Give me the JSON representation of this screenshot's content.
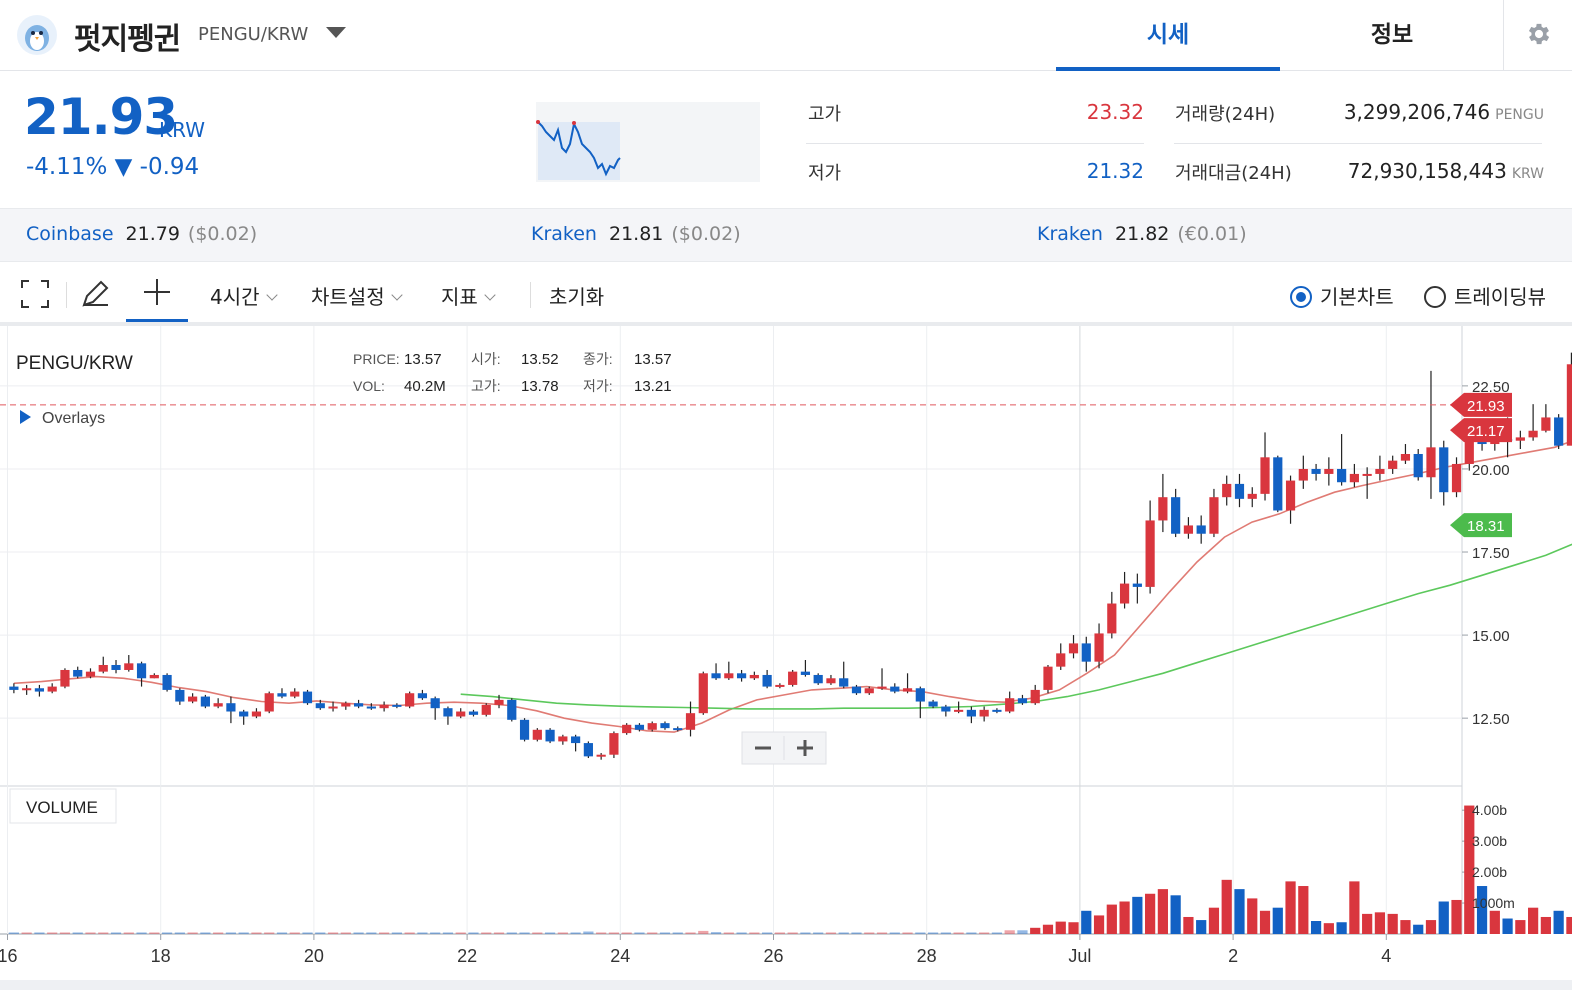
{
  "header": {
    "coin_name": "펏지펭귄",
    "pair": "PENGU/KRW",
    "tabs": [
      {
        "label": "시세",
        "active": true
      },
      {
        "label": "정보",
        "active": false
      }
    ]
  },
  "price": {
    "current": "21.93",
    "unit": "KRW",
    "change": "-4.11% ▼ -0.94",
    "color": "#1261c4"
  },
  "stats": {
    "high_label": "고가",
    "high": "23.32",
    "high_color": "#d9363e",
    "low_label": "저가",
    "low": "21.32",
    "low_color": "#1261c4",
    "volume_label": "거래량(24H)",
    "volume": "3,299,206,746",
    "volume_unit": "PENGU",
    "amount_label": "거래대금(24H)",
    "amount": "72,930,158,443",
    "amount_unit": "KRW"
  },
  "exchanges": [
    {
      "name": "Coinbase",
      "price": "21.79",
      "usd": "($0.02)"
    },
    {
      "name": "Kraken",
      "price": "21.81",
      "usd": "($0.02)"
    },
    {
      "name": "Kraken",
      "price": "21.82",
      "usd": "(€0.01)"
    }
  ],
  "toolbar": {
    "interval": "4시간",
    "chart_settings": "차트설정",
    "indicators": "지표",
    "reset": "초기화",
    "radio_basic": "기본차트",
    "radio_trading": "트레이딩뷰"
  },
  "chart_data": {
    "type": "candlestick",
    "symbol": "PENGU/KRW",
    "legend": {
      "price_label": "PRICE:",
      "price": "13.57",
      "open_label": "시가:",
      "open": "13.52",
      "close_label": "종가:",
      "close": "13.57",
      "vol_label": "VOL:",
      "vol": "40.2M",
      "high_label": "고가:",
      "high": "13.78",
      "low_label": "저가:",
      "low": "13.21"
    },
    "overlays_label": "Overlays",
    "volume_label": "VOLUME",
    "x_ticks": [
      "16",
      "18",
      "20",
      "22",
      "24",
      "26",
      "28",
      "Jul",
      "2",
      "4"
    ],
    "y_ticks": [
      "22.50",
      "20.00",
      "17.50",
      "15.00",
      "12.50"
    ],
    "volume_ticks": [
      "4.00b",
      "3.00b",
      "2.00b",
      "1000m"
    ],
    "ylim": [
      11.0,
      23.7
    ],
    "volume_lim": [
      0,
      4.2
    ],
    "current_price": "21.93",
    "ma_short_value": "21.17",
    "ma_long_value": "18.31",
    "colors": {
      "up": "#d9363e",
      "down": "#1261c4",
      "ma_short": "#e07b74",
      "ma_long": "#5cc85c",
      "ma_long_tag": "#4cbb4c"
    },
    "candles_per_day": 6,
    "first_candle_day": 16,
    "candles": [
      [
        13.45,
        13.35,
        13.55,
        13.25
      ],
      [
        13.35,
        13.4,
        13.5,
        13.2
      ],
      [
        13.4,
        13.3,
        13.5,
        13.15
      ],
      [
        13.3,
        13.45,
        13.55,
        13.25
      ],
      [
        13.45,
        13.95,
        14.0,
        13.4
      ],
      [
        13.95,
        13.75,
        14.05,
        13.7
      ],
      [
        13.75,
        13.9,
        14.0,
        13.7
      ],
      [
        13.9,
        14.1,
        14.35,
        13.85
      ],
      [
        14.1,
        13.95,
        14.25,
        13.85
      ],
      [
        13.95,
        14.15,
        14.4,
        13.9
      ],
      [
        14.15,
        13.7,
        14.2,
        13.45
      ],
      [
        13.7,
        13.8,
        13.85,
        13.7
      ],
      [
        13.8,
        13.35,
        13.85,
        13.3
      ],
      [
        13.35,
        13.0,
        13.4,
        12.9
      ],
      [
        13.0,
        13.15,
        13.25,
        12.95
      ],
      [
        13.15,
        12.85,
        13.2,
        12.8
      ],
      [
        12.85,
        12.95,
        13.1,
        12.8
      ],
      [
        12.95,
        12.7,
        13.15,
        12.35
      ],
      [
        12.7,
        12.55,
        12.75,
        12.3
      ],
      [
        12.55,
        12.7,
        12.8,
        12.5
      ],
      [
        12.7,
        13.25,
        13.3,
        12.65
      ],
      [
        13.25,
        13.15,
        13.4,
        13.1
      ],
      [
        13.15,
        13.3,
        13.4,
        13.1
      ],
      [
        13.3,
        12.95,
        13.35,
        12.9
      ],
      [
        12.95,
        12.8,
        13.05,
        12.75
      ],
      [
        12.8,
        12.85,
        13.0,
        12.7
      ],
      [
        12.85,
        12.95,
        13.0,
        12.75
      ],
      [
        12.95,
        12.85,
        13.05,
        12.8
      ],
      [
        12.85,
        12.8,
        12.95,
        12.75
      ],
      [
        12.8,
        12.9,
        13.0,
        12.7
      ],
      [
        12.9,
        12.85,
        12.95,
        12.8
      ],
      [
        12.85,
        13.25,
        13.3,
        12.8
      ],
      [
        13.25,
        13.1,
        13.35,
        13.05
      ],
      [
        13.1,
        12.8,
        13.15,
        12.45
      ],
      [
        12.8,
        12.55,
        12.85,
        12.3
      ],
      [
        12.55,
        12.7,
        12.8,
        12.5
      ],
      [
        12.7,
        12.6,
        12.75,
        12.55
      ],
      [
        12.6,
        12.9,
        12.95,
        12.55
      ],
      [
        12.9,
        13.05,
        13.2,
        12.8
      ],
      [
        13.05,
        12.45,
        13.1,
        12.4
      ],
      [
        12.45,
        11.85,
        12.5,
        11.8
      ],
      [
        11.85,
        12.15,
        12.2,
        11.8
      ],
      [
        12.15,
        11.8,
        12.2,
        11.75
      ],
      [
        11.8,
        11.95,
        12.0,
        11.7
      ],
      [
        11.95,
        11.75,
        12.0,
        11.5
      ],
      [
        11.75,
        11.35,
        11.8,
        11.3
      ],
      [
        11.35,
        11.4,
        11.45,
        11.25
      ],
      [
        11.4,
        12.05,
        12.1,
        11.3
      ],
      [
        12.05,
        12.3,
        12.35,
        12.0
      ],
      [
        12.3,
        12.15,
        12.35,
        12.1
      ],
      [
        12.15,
        12.35,
        12.4,
        12.1
      ],
      [
        12.35,
        12.2,
        12.4,
        12.15
      ],
      [
        12.2,
        12.15,
        12.25,
        12.1
      ],
      [
        12.15,
        12.65,
        13.0,
        11.95
      ],
      [
        12.65,
        13.85,
        13.9,
        12.6
      ],
      [
        13.85,
        13.7,
        14.15,
        13.65
      ],
      [
        13.7,
        13.85,
        14.2,
        13.65
      ],
      [
        13.85,
        13.7,
        13.95,
        13.6
      ],
      [
        13.7,
        13.8,
        13.9,
        13.65
      ],
      [
        13.8,
        13.45,
        13.95,
        13.4
      ],
      [
        13.45,
        13.5,
        13.55,
        13.4
      ],
      [
        13.5,
        13.9,
        13.95,
        13.45
      ],
      [
        13.9,
        13.8,
        14.25,
        13.75
      ],
      [
        13.8,
        13.55,
        13.85,
        13.5
      ],
      [
        13.55,
        13.7,
        13.8,
        13.5
      ],
      [
        13.7,
        13.45,
        14.2,
        13.4
      ],
      [
        13.45,
        13.25,
        13.5,
        13.2
      ],
      [
        13.25,
        13.4,
        13.45,
        13.2
      ],
      [
        13.4,
        13.45,
        14.0,
        13.35
      ],
      [
        13.45,
        13.3,
        13.55,
        13.25
      ],
      [
        13.3,
        13.4,
        13.85,
        13.25
      ],
      [
        13.4,
        13.0,
        13.45,
        12.5
      ],
      [
        13.0,
        12.85,
        13.05,
        12.8
      ],
      [
        12.85,
        12.7,
        12.9,
        12.55
      ],
      [
        12.7,
        12.75,
        13.0,
        12.65
      ],
      [
        12.75,
        12.55,
        12.85,
        12.35
      ],
      [
        12.55,
        12.75,
        12.85,
        12.4
      ],
      [
        12.75,
        12.7,
        12.8,
        12.65
      ],
      [
        12.7,
        13.1,
        13.3,
        12.65
      ],
      [
        13.1,
        12.95,
        13.2,
        12.9
      ],
      [
        12.95,
        13.35,
        13.5,
        12.9
      ],
      [
        13.35,
        14.05,
        14.1,
        13.25
      ],
      [
        14.05,
        14.45,
        14.75,
        13.95
      ],
      [
        14.45,
        14.75,
        15.0,
        14.3
      ],
      [
        14.75,
        14.2,
        14.95,
        13.9
      ],
      [
        14.2,
        15.05,
        15.35,
        14.0
      ],
      [
        15.05,
        15.95,
        16.3,
        14.9
      ],
      [
        15.95,
        16.55,
        16.9,
        15.8
      ],
      [
        16.55,
        16.45,
        16.85,
        15.95
      ],
      [
        16.45,
        18.45,
        19.05,
        16.25
      ],
      [
        18.45,
        19.15,
        19.85,
        18.1
      ],
      [
        19.15,
        18.05,
        19.4,
        17.95
      ],
      [
        18.05,
        18.3,
        18.55,
        17.9
      ],
      [
        18.3,
        18.05,
        18.6,
        17.75
      ],
      [
        18.05,
        19.15,
        19.4,
        17.95
      ],
      [
        19.15,
        19.55,
        19.8,
        18.9
      ],
      [
        19.55,
        19.1,
        19.85,
        18.85
      ],
      [
        19.1,
        19.25,
        19.45,
        18.85
      ],
      [
        19.25,
        20.35,
        21.1,
        19.05
      ],
      [
        20.35,
        18.75,
        20.4,
        18.7
      ],
      [
        18.75,
        19.65,
        19.8,
        18.35
      ],
      [
        19.65,
        20.0,
        20.4,
        19.4
      ],
      [
        20.0,
        19.85,
        20.15,
        19.65
      ],
      [
        19.85,
        20.0,
        20.35,
        19.5
      ],
      [
        20.0,
        19.6,
        21.05,
        19.5
      ],
      [
        19.6,
        19.85,
        20.15,
        19.45
      ],
      [
        19.85,
        19.85,
        20.05,
        19.1
      ],
      [
        19.85,
        20.0,
        20.4,
        19.65
      ],
      [
        20.0,
        20.25,
        20.4,
        19.85
      ],
      [
        20.25,
        20.45,
        20.75,
        20.15
      ],
      [
        20.45,
        19.75,
        20.6,
        19.65
      ],
      [
        19.75,
        20.65,
        22.95,
        19.1
      ],
      [
        20.65,
        19.3,
        20.85,
        18.9
      ],
      [
        19.3,
        20.15,
        20.35,
        19.15
      ],
      [
        20.15,
        20.85,
        21.05,
        19.95
      ],
      [
        20.85,
        20.75,
        21.15,
        20.55
      ],
      [
        20.75,
        20.9,
        21.05,
        20.55
      ],
      [
        20.9,
        20.85,
        21.55,
        20.35
      ],
      [
        20.85,
        20.95,
        21.15,
        20.6
      ],
      [
        20.95,
        21.15,
        21.95,
        20.85
      ],
      [
        21.15,
        21.55,
        21.95,
        21.1
      ],
      [
        21.55,
        20.7,
        21.65,
        20.6
      ],
      [
        20.7,
        23.15,
        23.5,
        20.85
      ],
      [
        23.15,
        22.95,
        23.45,
        22.85
      ],
      [
        22.95,
        21.95,
        23.2,
        21.75
      ],
      [
        21.95,
        21.65,
        22.05,
        21.55
      ]
    ],
    "volumes": [
      0.05,
      0.05,
      0.05,
      0.05,
      0.05,
      0.05,
      0.05,
      0.05,
      0.05,
      0.05,
      0.05,
      0.05,
      0.05,
      0.05,
      0.05,
      0.05,
      0.05,
      0.05,
      0.05,
      0.05,
      0.05,
      0.05,
      0.05,
      0.05,
      0.05,
      0.05,
      0.05,
      0.05,
      0.05,
      0.05,
      0.05,
      0.05,
      0.05,
      0.05,
      0.05,
      0.05,
      0.05,
      0.05,
      0.05,
      0.05,
      0.05,
      0.05,
      0.05,
      0.05,
      0.05,
      0.08,
      0.05,
      0.05,
      0.05,
      0.05,
      0.05,
      0.05,
      0.05,
      0.05,
      0.1,
      0.06,
      0.05,
      0.05,
      0.05,
      0.05,
      0.05,
      0.05,
      0.05,
      0.05,
      0.05,
      0.05,
      0.05,
      0.05,
      0.05,
      0.05,
      0.05,
      0.05,
      0.05,
      0.05,
      0.05,
      0.05,
      0.05,
      0.05,
      0.12,
      0.12,
      0.2,
      0.3,
      0.4,
      0.38,
      0.75,
      0.6,
      0.95,
      1.05,
      1.2,
      1.3,
      1.45,
      1.25,
      0.55,
      0.45,
      0.85,
      1.75,
      1.45,
      1.15,
      0.75,
      0.85,
      1.7,
      1.55,
      0.42,
      0.35,
      0.38,
      1.7,
      0.65,
      0.7,
      0.65,
      0.45,
      0.3,
      0.45,
      1.05,
      1.1,
      4.15,
      1.55,
      0.75,
      0.5,
      0.45,
      0.85,
      0.55,
      0.75,
      0.55,
      0.6,
      0.35,
      0.6,
      0.72,
      0.15,
      0,
      0,
      0,
      0
    ],
    "ma_short": [
      13.55,
      13.6,
      13.68,
      13.75,
      13.7,
      13.58,
      13.42,
      13.3,
      13.12,
      13.0,
      12.95,
      13.02,
      12.95,
      12.9,
      12.88,
      12.95,
      12.98,
      12.95,
      12.88,
      12.72,
      12.5,
      12.35,
      12.25,
      12.12,
      12.08,
      12.35,
      12.75,
      13.05,
      13.2,
      13.35,
      13.4,
      13.45,
      13.35,
      13.3,
      13.15,
      13.02,
      12.98,
      13.1,
      13.35,
      13.85,
      14.4,
      15.35,
      16.3,
      17.2,
      17.95,
      18.4,
      18.65,
      19.0,
      19.3,
      19.5,
      19.68,
      19.85,
      20.05,
      20.2,
      20.35,
      20.5,
      20.65,
      20.95,
      21.17
    ],
    "ma_long": [
      13.22,
      13.15,
      13.05,
      12.95,
      12.9,
      12.86,
      12.84,
      12.82,
      12.8,
      12.78,
      12.78,
      12.78,
      12.8,
      12.8,
      12.8,
      12.82,
      12.85,
      12.92,
      13.0,
      13.15,
      13.35,
      13.6,
      13.85,
      14.15,
      14.45,
      14.75,
      15.05,
      15.35,
      15.65,
      15.95,
      16.25,
      16.5,
      16.8,
      17.1,
      17.4,
      17.8,
      18.31
    ]
  }
}
